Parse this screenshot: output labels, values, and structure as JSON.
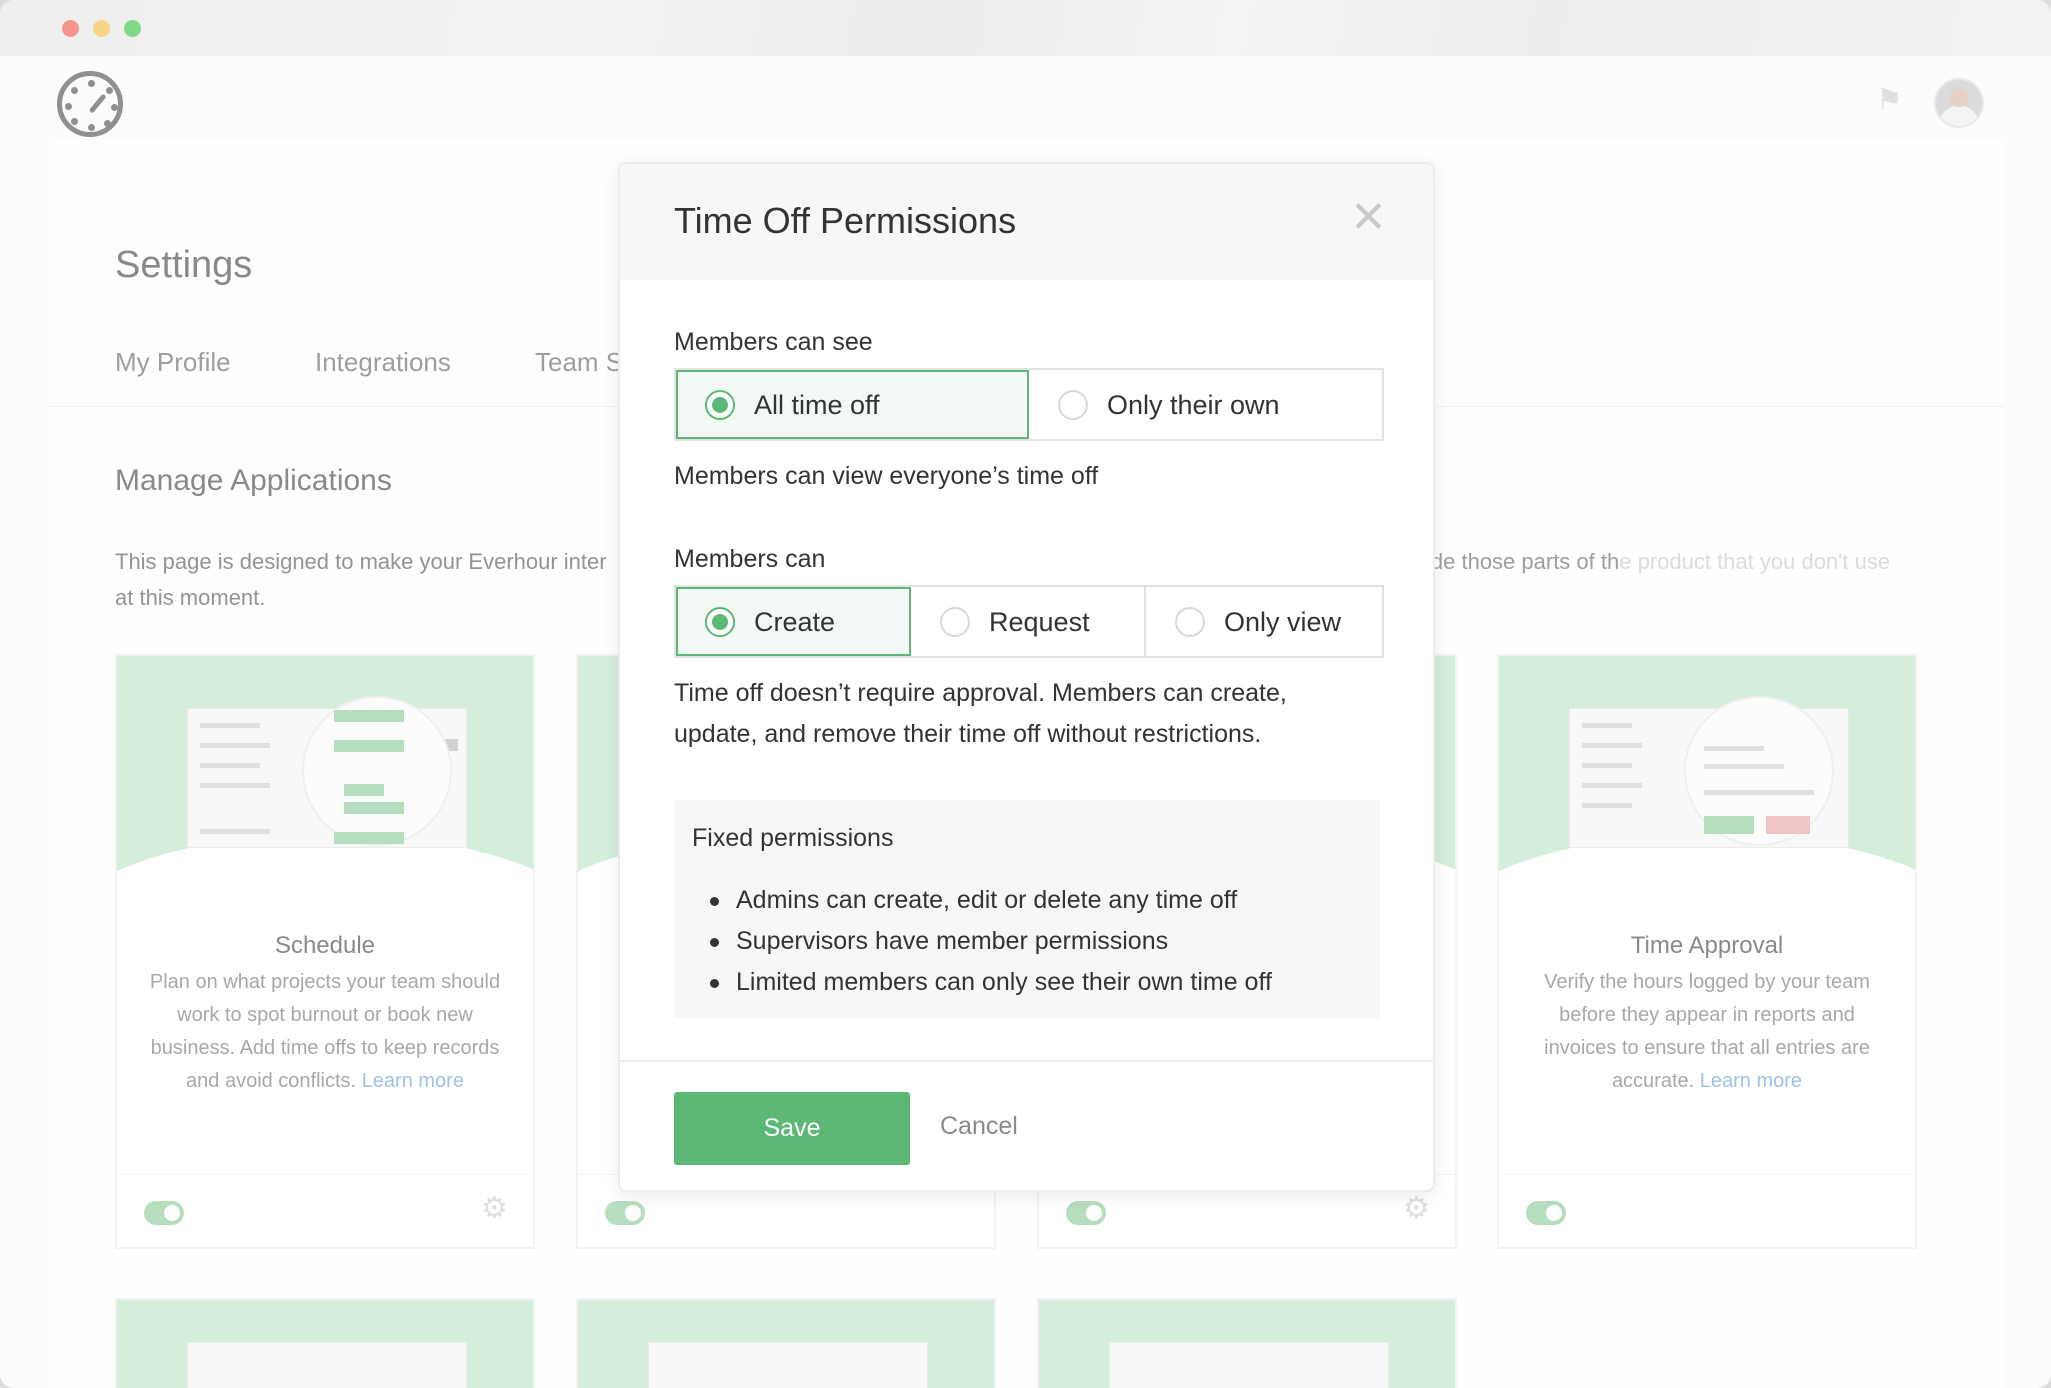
{
  "window": {
    "traffic_lights": [
      "close",
      "minimize",
      "zoom"
    ]
  },
  "header": {
    "logo_icon": "stopwatch-logo-icon",
    "notification_icon": "bell-icon",
    "avatar": "user-avatar"
  },
  "settings": {
    "title": "Settings",
    "tabs": [
      "My Profile",
      "Integrations",
      "Team S"
    ],
    "section_title": "Manage Applications",
    "description_left": "This page is designed to make your Everhour inter",
    "description_line2": "at this moment.",
    "description_right_a": "ide those parts of th",
    "description_right_b": "e product that you don't use"
  },
  "cards": [
    {
      "title": "Schedule",
      "text": "Plan on what projects your team should work to spot burnout or book new business. Add time offs to keep records and avoid conflicts.",
      "link": "Learn more",
      "enabled": true,
      "has_settings": true
    },
    {
      "title": "Time Approval",
      "text": "Verify the hours logged by your team before they appear in reports and invoices to ensure that all entries are accurate.",
      "link": "Learn more",
      "enabled": true,
      "has_settings": false
    }
  ],
  "modal": {
    "title": "Time Off Permissions",
    "close_icon": "close-icon",
    "see_group": {
      "label": "Members can see",
      "options": [
        "All time off",
        "Only their own"
      ],
      "selected": "All time off",
      "help": "Members can view everyone’s time off"
    },
    "can_group": {
      "label": "Members can",
      "options": [
        "Create",
        "Request",
        "Only view"
      ],
      "selected": "Create",
      "help_line1": "Time off doesn’t require approval. Members can create,",
      "help_line2": "update, and remove their time off without restrictions."
    },
    "fixed": {
      "title": "Fixed permissions",
      "items": [
        "Admins can create, edit or delete any time off",
        "Supervisors have member permissions",
        "Limited members can only see their own time off"
      ]
    },
    "save_label": "Save",
    "cancel_label": "Cancel"
  },
  "colors": {
    "accent": "#5cb874",
    "card_hero": "#bfe3c8",
    "link": "#6aa3d8"
  }
}
